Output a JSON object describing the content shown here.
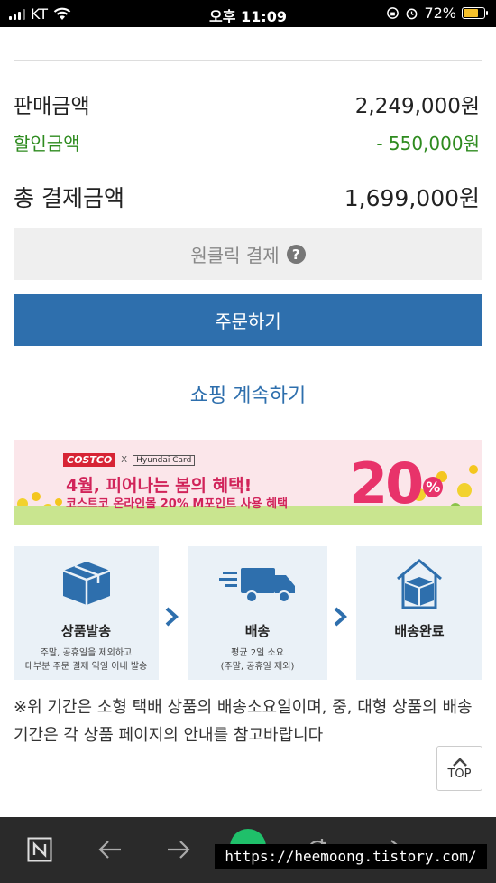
{
  "status_bar": {
    "carrier": "KT",
    "time": "오후 11:09",
    "battery_percent": "72%",
    "battery_level": 0.72
  },
  "summary": {
    "price_label": "판매금액",
    "price_value": "2,249,000원",
    "discount_label": "할인금액",
    "discount_value": "- 550,000원",
    "total_label": "총 결제금액",
    "total_value": "1,699,000원"
  },
  "buttons": {
    "oneclick_label": "원클릭 결제",
    "order_label": "주문하기",
    "continue_label": "쇼핑 계속하기"
  },
  "banner": {
    "costco_logo": "COSTCO",
    "x_mark": "X",
    "card_logo": "Hyundai Card",
    "headline": "4월, 피어나는 봄의 혜택!",
    "sub": "코스트코 온라인몰 20% M포인트 사용 혜택",
    "percent": "20",
    "percent_sign": "%"
  },
  "delivery_steps": [
    {
      "title": "상품발송",
      "desc_line1": "주말, 공휴일을 제외하고",
      "desc_line2": "대부분 주문 결제 익일 이내 발송",
      "icon": "box-icon"
    },
    {
      "title": "배송",
      "desc_line1": "평균 2일 소요",
      "desc_line2": "(주말, 공휴일 제외)",
      "icon": "truck-icon"
    },
    {
      "title": "배송완료",
      "desc_line1": "",
      "desc_line2": "",
      "icon": "house-box-icon"
    }
  ],
  "notice": "※위 기간은 소형 택배 상품의 배송소요일이며, 중, 대형 상품의 배송기간은 각 상품 페이지의 안내를 참고바랍니다",
  "top_button": "TOP",
  "watermark": "https://heemoong.tistory.com/",
  "colors": {
    "accent_blue": "#2e6fad",
    "discount_green": "#2e8b1f",
    "banner_pink": "#e8336a"
  }
}
